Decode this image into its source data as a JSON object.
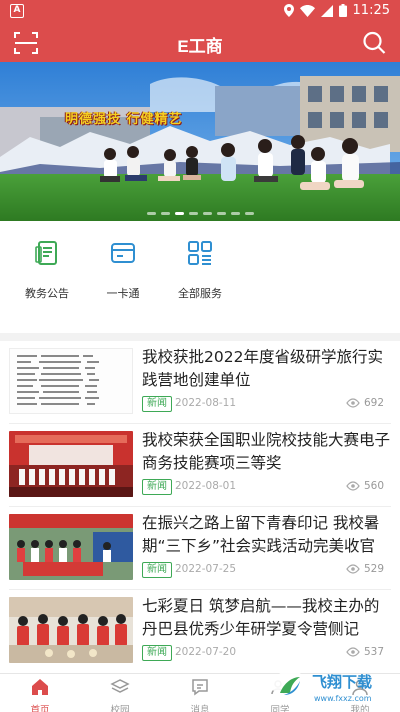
{
  "status_bar": {
    "time": "11:25"
  },
  "header": {
    "title": "E工商"
  },
  "banner": {
    "slogan": "明德强技  行健精艺"
  },
  "quick_actions": [
    {
      "label": "教务公告",
      "icon": "notice-doc-icon"
    },
    {
      "label": "一卡通",
      "icon": "card-icon"
    },
    {
      "label": "全部服务",
      "icon": "grid-icon"
    }
  ],
  "news": [
    {
      "title": "我校获批2022年度省级研学旅行实践营地创建单位",
      "tag": "新闻",
      "date": "2022-08-11",
      "views": "692"
    },
    {
      "title": "我校荣获全国职业院校技能大赛电子商务技能赛项三等奖",
      "tag": "新闻",
      "date": "2022-08-01",
      "views": "560"
    },
    {
      "title": "在振兴之路上留下青春印记  我校暑期“三下乡”社会实践活动完美收官",
      "tag": "新闻",
      "date": "2022-07-25",
      "views": "529"
    },
    {
      "title": "七彩夏日  筑梦启航——我校主办的丹巴县优秀少年研学夏令营侧记",
      "tag": "新闻",
      "date": "2022-07-20",
      "views": "537"
    }
  ],
  "tabs": [
    {
      "label": "首页",
      "active": true
    },
    {
      "label": "校园",
      "active": false
    },
    {
      "label": "消息",
      "active": false
    },
    {
      "label": "同学",
      "active": false
    },
    {
      "label": "我的",
      "active": false
    }
  ],
  "watermark": {
    "name": "飞翔下载",
    "url": "www.fxxz.com"
  },
  "colors": {
    "brand": "#dc4c4c",
    "tag_green": "#3ea956",
    "icon_green": "#3ea956",
    "icon_blue": "#2f8fd1"
  }
}
